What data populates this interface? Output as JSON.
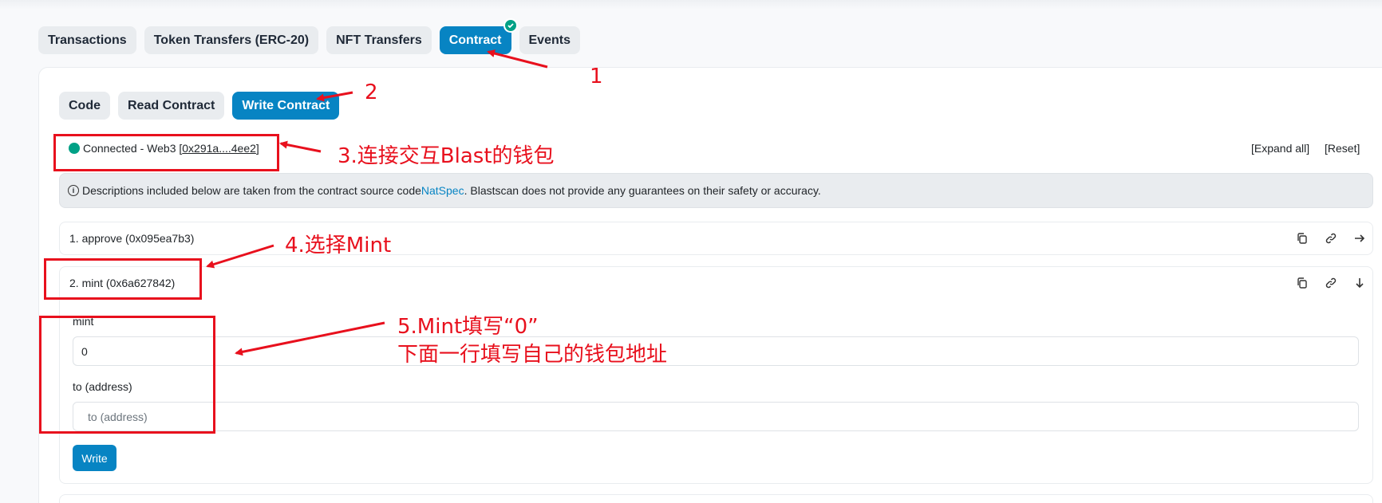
{
  "tabs": [
    "Transactions",
    "Token Transfers (ERC-20)",
    "NFT Transfers",
    "Contract",
    "Events"
  ],
  "subtabs": [
    "Code",
    "Read Contract",
    "Write Contract"
  ],
  "connection": {
    "prefix": "Connected - Web3 [",
    "address": "0x291a....4ee2",
    "suffix": "]"
  },
  "actions": {
    "expand_all": "[Expand all]",
    "reset": "[Reset]"
  },
  "notice": {
    "before": "Descriptions included below are taken from the contract source code ",
    "link": "NatSpec",
    "after": ". Blastscan does not provide any guarantees on their safety or accuracy."
  },
  "functions": [
    {
      "label": "1. approve (0x095ea7b3)"
    },
    {
      "label": "2. mint (0x6a627842)"
    }
  ],
  "mint_form": {
    "field1_label": "mint",
    "field1_value": "0",
    "field2_label": "to (address)",
    "field2_placeholder": "to (address)",
    "write_label": "Write"
  },
  "annotations": {
    "a1": "1",
    "a2": "2",
    "a3": "3.连接交互Blast的钱包",
    "a4": "4.选择Mint",
    "a5_line1": "5.Mint填写“0”",
    "a5_line2": "下面一行填写自己的钱包地址"
  },
  "colors": {
    "primary": "#0784c3",
    "success": "#00a186",
    "annotation": "#e8101d"
  }
}
